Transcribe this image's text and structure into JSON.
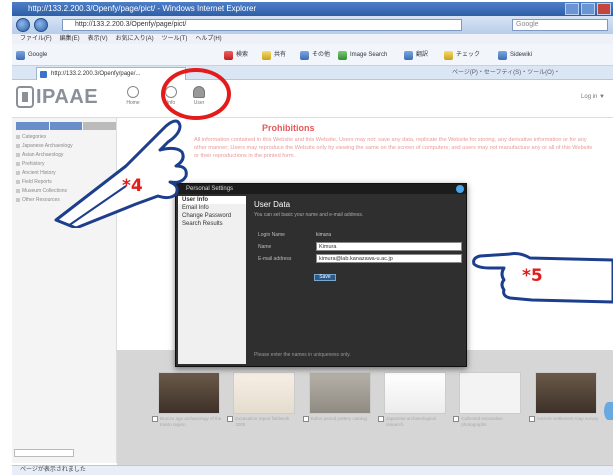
{
  "browser": {
    "title": "http://133.2.200.3/Openfy/page/pict/ - Windows Internet Explorer",
    "url": "http://133.2.200.3/Openfy/page/pict/",
    "search_placeholder": "Google",
    "tab_label": "http://133.2.200.3/Openfy/page/...",
    "menu_items": [
      "ファイル(F)",
      "編集(E)",
      "表示(V)",
      "お気に入り(A)",
      "ツール(T)",
      "ヘルプ(H)"
    ],
    "toolbar_items": [
      "Google",
      "検索",
      "共有",
      "その他",
      "Image Search",
      "翻訳",
      "チェック",
      "Sidewiki"
    ],
    "command_bar": "ページ(P)・セーフティ(S)・ツール(O)・"
  },
  "site": {
    "logo_text": "IPAAE",
    "header_right": "Log in ▼",
    "header_icons": [
      "Home",
      "Info",
      "User"
    ]
  },
  "sidebar": {
    "items": [
      "Categories",
      "Japanese Archaeology",
      "Asian Archaeology",
      "Prehistory",
      "Ancient History",
      "Field Reports",
      "Museum Collections",
      "Other Resources"
    ]
  },
  "notice": {
    "title": "Prohibitions",
    "text": "All information contained in this Website and this Website, Users may not: save any data, replicate the Website for storing, any derivative information or for any other manner; Users may reproduce the Website only by viewing the same on the screen of computers; and users may not manufacture any or all of this Website or their reproductions in the printed form."
  },
  "modal": {
    "title": "Personal Settings",
    "menu": [
      "User Info",
      "Email Info",
      "Change Password",
      "Search Results"
    ],
    "body_title": "User Data",
    "body_desc": "You can set basic your name and e-mail address.",
    "login_name_label": "Login Name",
    "login_name_value": "kimura",
    "name_label": "Name",
    "name_value": "Kimura",
    "email_label": "E-mail address",
    "email_value": "kimura@lab.kanazawa-u.ac.jp",
    "save_label": "Save",
    "footer": "Please enter the names in uniqueness only."
  },
  "thumbnails": [
    {
      "caption": "Bronze age archaeology of the Kanto region",
      "style": "dark"
    },
    {
      "caption": "Excavation report fieldwork 2009",
      "style": "light"
    },
    {
      "caption": "Kofun period pottery catalog",
      "style": "grey"
    },
    {
      "caption": "Japanese archaeological research",
      "style": "doc"
    },
    {
      "caption": "Collected excavation photographs",
      "style": "paper"
    },
    {
      "caption": "Ancient settlement map survey",
      "style": "dark"
    }
  ],
  "status": {
    "text": "ページが表示されました"
  },
  "annotations": {
    "label_4": "*4",
    "label_5": "*5"
  }
}
